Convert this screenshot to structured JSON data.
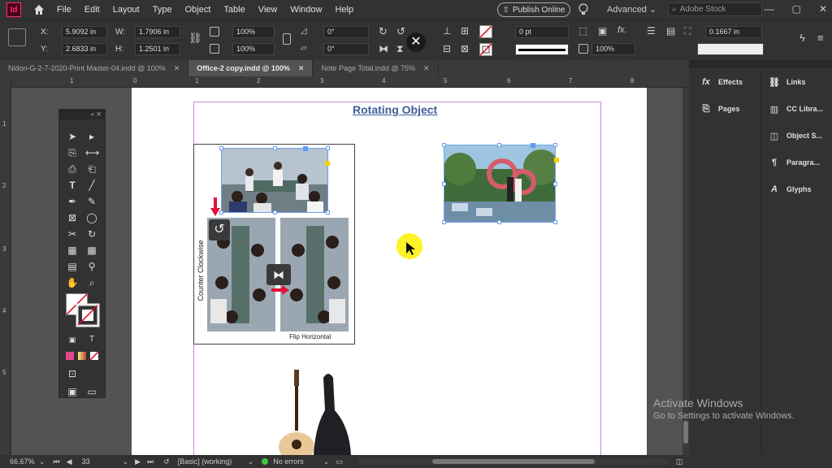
{
  "menubar": {
    "app_icon": "Id",
    "items": [
      "File",
      "Edit",
      "Layout",
      "Type",
      "Object",
      "Table",
      "View",
      "Window",
      "Help"
    ],
    "publish_label": "Publish Online",
    "workspace": "Advanced",
    "stock_placeholder": "Adobe Stock"
  },
  "control": {
    "x_label": "X:",
    "x_value": "5.9092 in",
    "y_label": "Y:",
    "y_value": "2.6833 in",
    "w_label": "W:",
    "w_value": "1.7906 in",
    "h_label": "H:",
    "h_value": "1.2501 in",
    "scale_x": "100%",
    "scale_y": "100%",
    "rotate": "0°",
    "shear": "0°",
    "stroke_weight": "0 pt",
    "opacity": "100%",
    "ref_value": "0.1667 in"
  },
  "tabs": [
    {
      "label": "Nidon-G-2-7-2020-Print Master-04.indd @ 100%",
      "active": false
    },
    {
      "label": "Office-2 copy.indd @ 100%",
      "active": true
    },
    {
      "label": "Note Page  Total.indd @ 75%",
      "active": false
    }
  ],
  "ruler": {
    "h_ticks": [
      "1",
      "0",
      "1",
      "2",
      "3",
      "4",
      "5",
      "6",
      "7",
      "8"
    ],
    "v_ticks": [
      "1",
      "2",
      "3",
      "4",
      "5"
    ]
  },
  "document": {
    "title": "Rotating Object",
    "label_ccw": "Counter Clockwise",
    "label_flip": "Flip Horizontal"
  },
  "panels": {
    "left": [
      {
        "label": "Effects",
        "icon": "fx-icon"
      },
      {
        "label": "Pages",
        "icon": "pages-icon"
      }
    ],
    "right": [
      {
        "label": "Links",
        "icon": "links-icon"
      },
      {
        "label": "CC Libra...",
        "icon": "cc-libraries-icon"
      },
      {
        "label": "Object S...",
        "icon": "object-styles-icon"
      },
      {
        "label": "Paragra...",
        "icon": "paragraph-styles-icon"
      },
      {
        "label": "Glyphs",
        "icon": "glyphs-icon"
      }
    ]
  },
  "status": {
    "zoom": "66.67%",
    "page": "33",
    "style": "[Basic] (working)",
    "errors": "No errors"
  },
  "watermark": {
    "line1": "Activate Windows",
    "line2": "Go to Settings to activate Windows."
  }
}
